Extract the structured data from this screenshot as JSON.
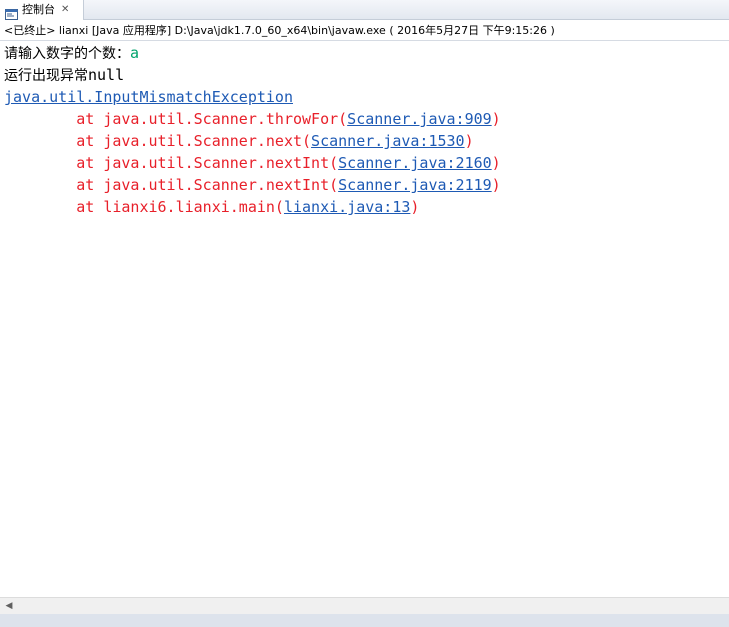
{
  "tab": {
    "label": "控制台",
    "icon": "console-icon",
    "close_icon": "close-icon",
    "close_glyph": "✕"
  },
  "header": {
    "text": "<已终止> lianxi [Java 应用程序] D:\\Java\\jdk1.7.0_60_x64\\bin\\javaw.exe ( 2016年5月27日 下午9:15:26 )"
  },
  "console": {
    "prompt": "请输入数字的个数：",
    "user_input": "a",
    "error_message_cn": "运行出现异常",
    "error_message_suffix": "null",
    "exception_name": "java.util.InputMismatchException",
    "stack": [
      {
        "prefix": "        at java.util.Scanner.throwFor(",
        "link": "Scanner.java:909",
        "suffix": ")"
      },
      {
        "prefix": "        at java.util.Scanner.next(",
        "link": "Scanner.java:1530",
        "suffix": ")"
      },
      {
        "prefix": "        at java.util.Scanner.nextInt(",
        "link": "Scanner.java:2160",
        "suffix": ")"
      },
      {
        "prefix": "        at java.util.Scanner.nextInt(",
        "link": "Scanner.java:2119",
        "suffix": ")"
      },
      {
        "prefix": "        at lianxi6.lianxi.main(",
        "link": "lianxi.java:13",
        "suffix": ")"
      }
    ]
  },
  "scrollbar": {
    "left_arrow": "◀"
  },
  "colors": {
    "stdout": "#000000",
    "stdin": "#00a36c",
    "stderr": "#e8202a",
    "link": "#1e5ab4"
  }
}
